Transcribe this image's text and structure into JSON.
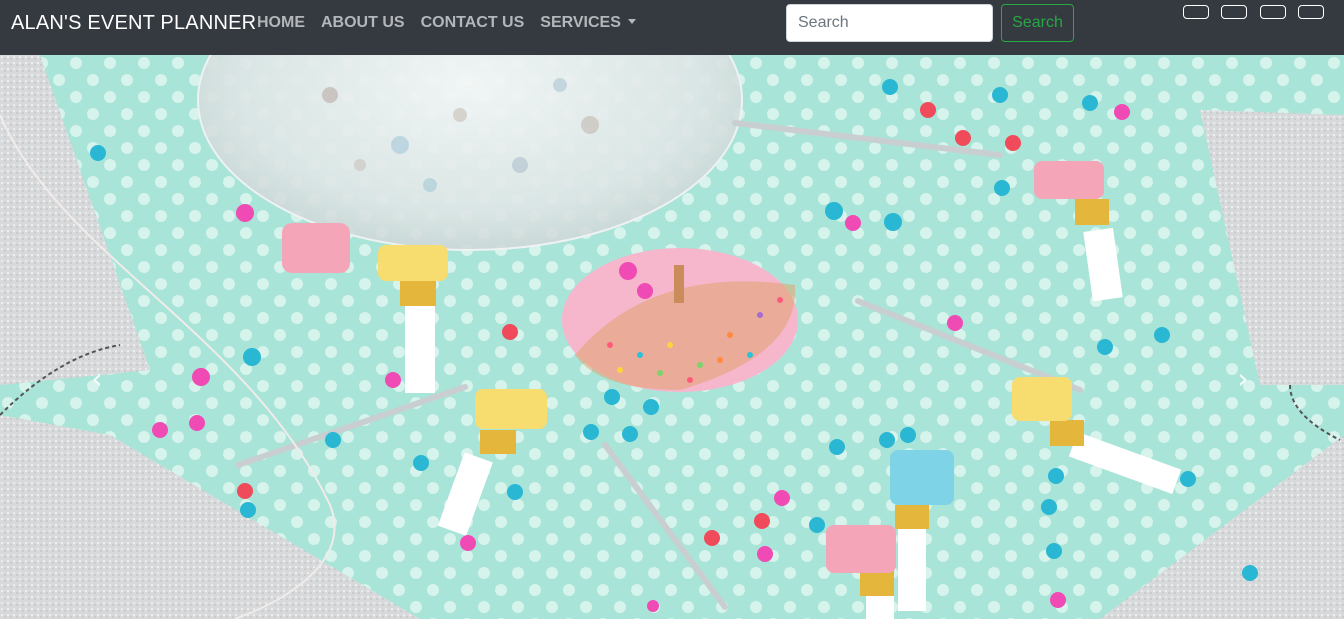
{
  "navbar": {
    "brand": "ALAN'S EVENT PLANNER",
    "links": [
      {
        "label": "HOME"
      },
      {
        "label": "ABOUT US"
      },
      {
        "label": "CONTACT US"
      },
      {
        "label": "SERVICES"
      }
    ],
    "search": {
      "placeholder": "Search",
      "value": "",
      "button_label": "Search"
    },
    "social_buttons": [
      {
        "icon": "social-icon-1"
      },
      {
        "icon": "social-icon-2"
      },
      {
        "icon": "social-icon-3"
      },
      {
        "icon": "social-icon-4"
      }
    ]
  },
  "carousel": {
    "prev_icon": "‹",
    "next_icon": "›",
    "slide_image": "party-table-with-balloon-donut-and-blowers",
    "colors": {
      "background": "#a9e4d8",
      "navbar": "#343a40",
      "accent": "#28a745"
    }
  }
}
